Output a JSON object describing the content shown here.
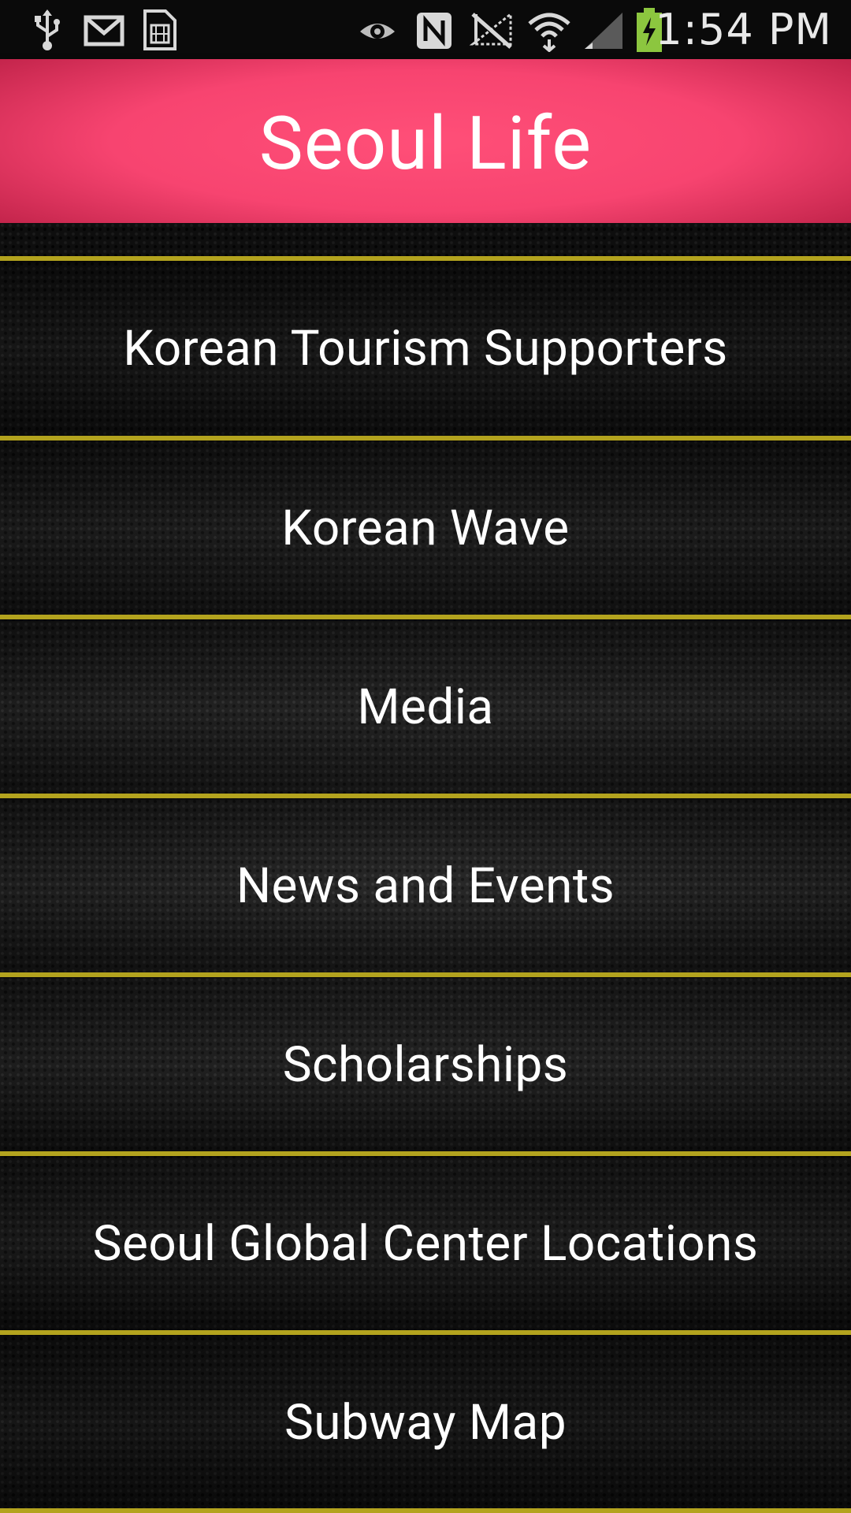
{
  "status_bar": {
    "time": "1:54 PM",
    "icons": [
      "usb-icon",
      "gmail-icon",
      "sim-card-icon",
      "eye-icon",
      "nfc-icon",
      "no-signal-icon",
      "wifi-icon",
      "cell-signal-icon",
      "battery-charging-icon"
    ]
  },
  "header": {
    "title": "Seoul Life"
  },
  "menu": {
    "items": [
      {
        "label": "Korean Tourism Supporters"
      },
      {
        "label": "Korean Wave"
      },
      {
        "label": "Media"
      },
      {
        "label": "News and Events"
      },
      {
        "label": "Scholarships"
      },
      {
        "label": "Seoul Global Center Locations"
      },
      {
        "label": "Subway Map"
      }
    ]
  },
  "colors": {
    "header": "#f74470",
    "divider": "#b3a31e",
    "background": "#161616"
  }
}
